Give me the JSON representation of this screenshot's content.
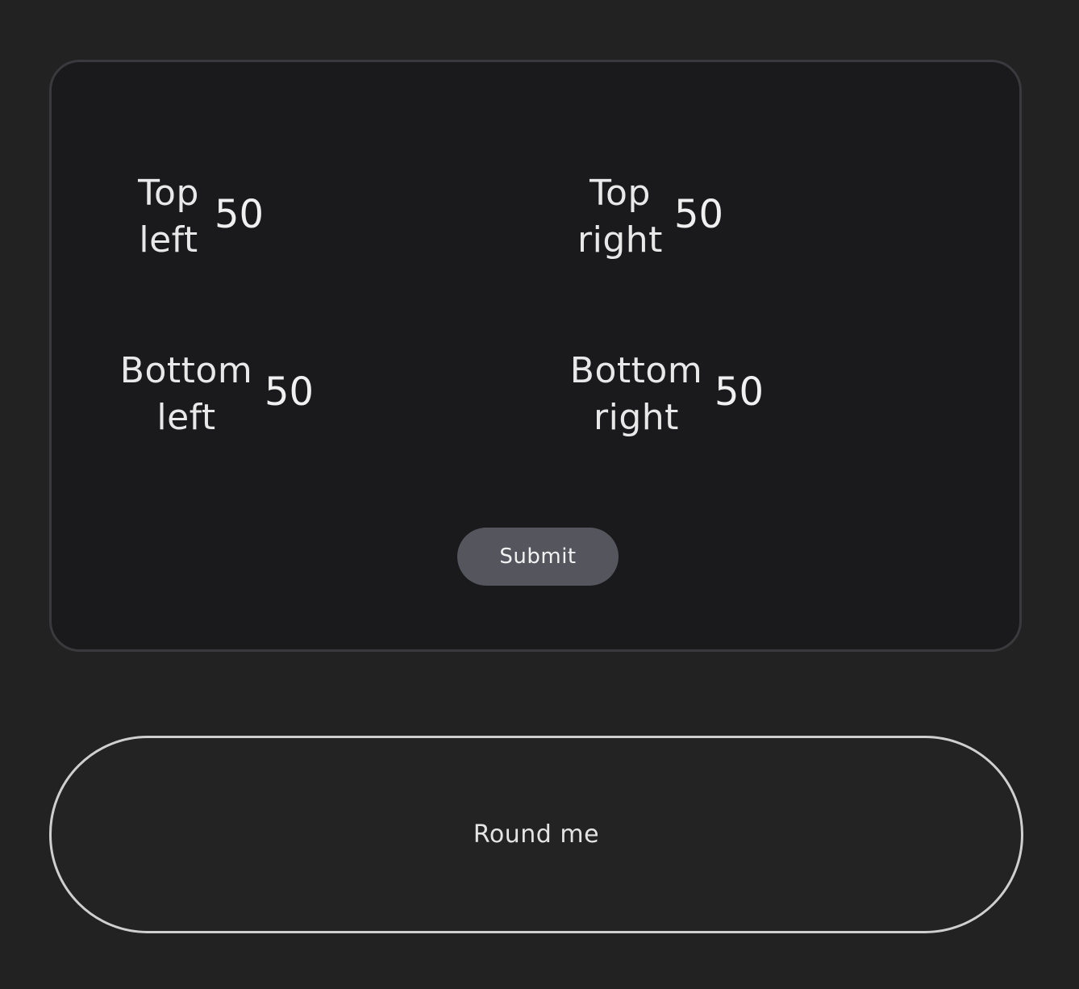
{
  "form": {
    "fields": [
      {
        "label": "Top left",
        "value": "50"
      },
      {
        "label": "Top right",
        "value": "50"
      },
      {
        "label": "Bottom left",
        "value": "50"
      },
      {
        "label": "Bottom right",
        "value": "50"
      }
    ],
    "submit_label": "Submit"
  },
  "preview": {
    "label": "Round me"
  },
  "colors": {
    "page_background": "#222222",
    "card_background": "#1a1a1c",
    "card_border": "#3a393e",
    "button_background": "#55565d",
    "preview_border": "#cfcfcf"
  }
}
